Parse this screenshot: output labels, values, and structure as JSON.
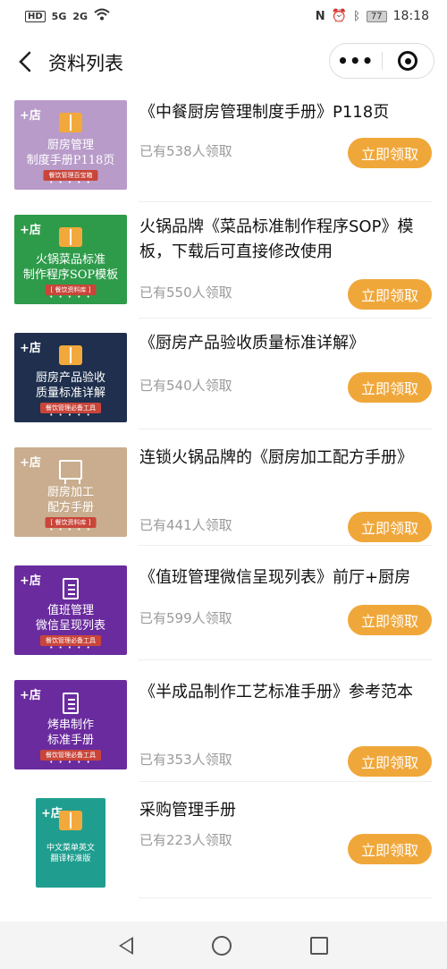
{
  "status_bar": {
    "left": [
      "HD",
      "5G",
      "2G",
      "wifi"
    ],
    "battery": "77",
    "time": "18:18"
  },
  "header": {
    "title": "资料列表",
    "more_icon": "more-dots-icon",
    "close_icon": "target-icon"
  },
  "items": [
    {
      "title": "《中餐厨房管理制度手册》P118页",
      "count": "已有538人领取",
      "button": "立即领取",
      "cover": {
        "color": "#b89bc9",
        "lines": [
          "厨房管理",
          "制度手册P118页"
        ],
        "badge": "餐饮管理百宝箱",
        "icon": "book-icon"
      }
    },
    {
      "title": "火锅品牌《菜品标准制作程序SOP》模板，下载后可直接修改使用",
      "count": "已有550人领取",
      "button": "立即领取",
      "cover": {
        "color": "#2e9b4a",
        "lines": [
          "火锅菜品标准",
          "制作程序SOP模板"
        ],
        "badge": "[ 餐饮资料库 ]",
        "icon": "book-icon"
      }
    },
    {
      "title": "《厨房产品验收质量标准详解》",
      "count": "已有540人领取",
      "button": "立即领取",
      "cover": {
        "color": "#1f2f4d",
        "lines": [
          "厨房产品验收",
          "质量标准详解"
        ],
        "badge": "餐饮管理必备工具",
        "icon": "book-icon"
      }
    },
    {
      "title": "连锁火锅品牌的《厨房加工配方手册》",
      "count": "已有441人领取",
      "button": "立即领取",
      "cover": {
        "color": "#c9ad8e",
        "lines": [
          "厨房加工",
          "配方手册"
        ],
        "badge": "[ 餐饮资料库 ]",
        "icon": "board-icon"
      }
    },
    {
      "title": "《值班管理微信呈现列表》前厅+厨房",
      "count": "已有599人领取",
      "button": "立即领取",
      "cover": {
        "color": "#6a2b9e",
        "lines": [
          "值班管理",
          "微信呈现列表"
        ],
        "badge": "餐饮管理必备工具",
        "icon": "list-icon"
      }
    },
    {
      "title": "《半成品制作工艺标准手册》参考范本",
      "count": "已有353人领取",
      "button": "立即领取",
      "cover": {
        "color": "#6a2b9e",
        "lines": [
          "烤串制作",
          "标准手册"
        ],
        "badge": "餐饮管理必备工具",
        "icon": "list-icon"
      }
    },
    {
      "title": "采购管理手册",
      "count": "已有223人领取",
      "button": "立即领取",
      "cover": {
        "color": "#1f9e8f",
        "lines": [
          "中文菜单英文",
          "翻译标准版"
        ],
        "badge": "",
        "icon": "book-icon"
      }
    }
  ],
  "cover_logo": "+店",
  "cover_dots": "• • • • •",
  "system_nav": [
    "back-icon",
    "home-icon",
    "recent-apps-icon"
  ]
}
